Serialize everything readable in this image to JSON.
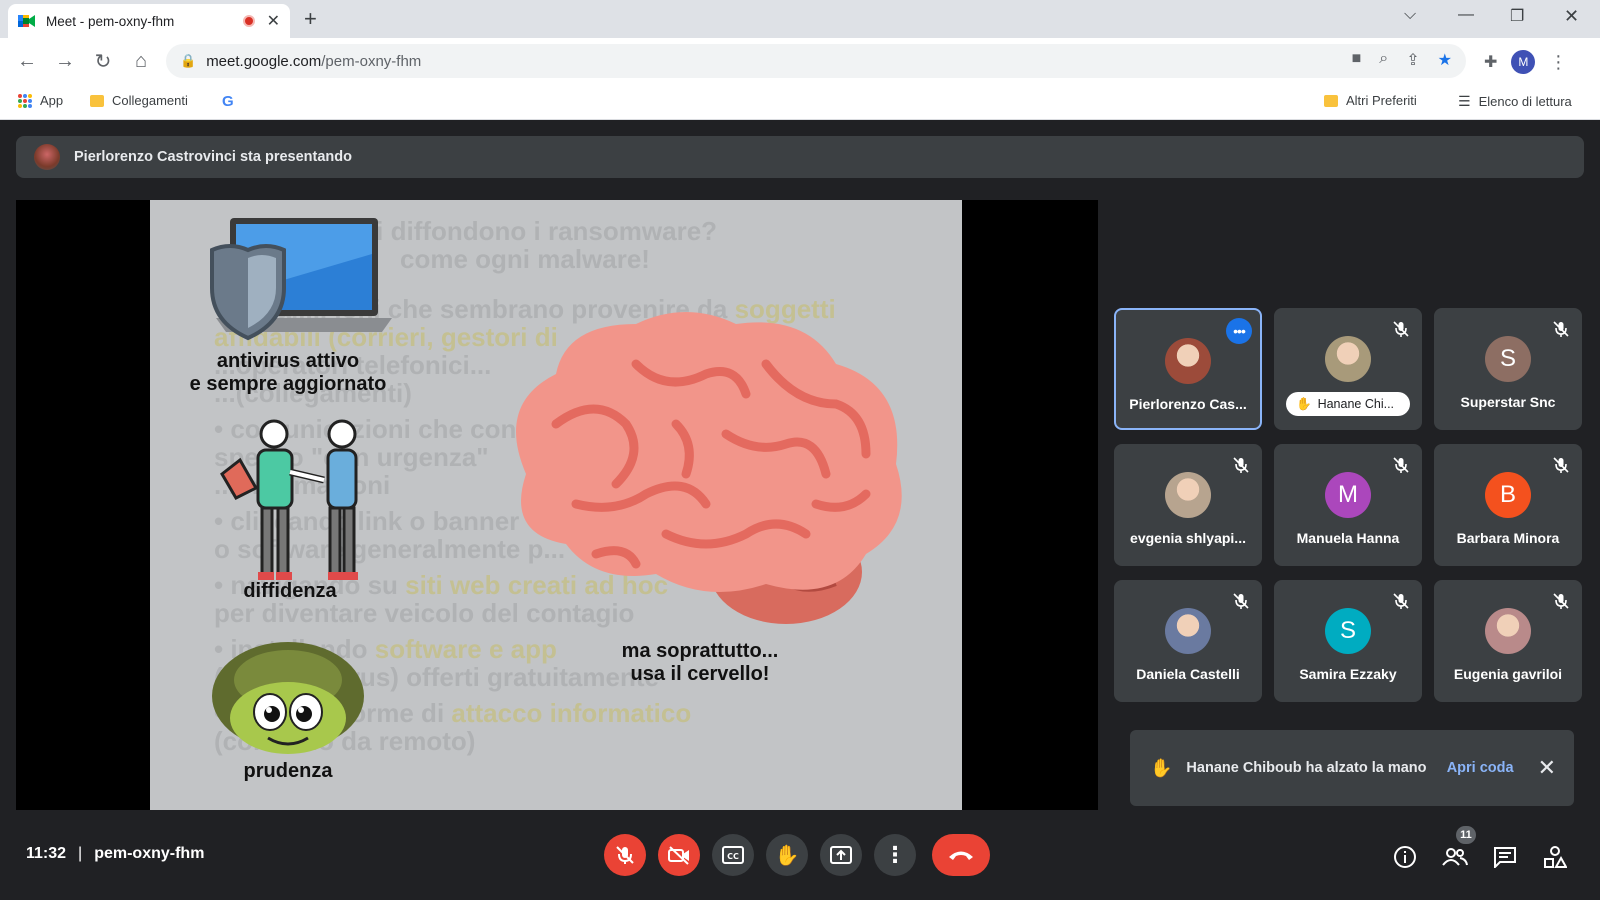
{
  "browser": {
    "tab_title": "Meet - pem-oxny-fhm",
    "tab_close": "✕",
    "new_tab": "+",
    "url_host": "meet.google.com",
    "url_path": "/pem-oxny-fhm",
    "bookmarks": {
      "apps": "App",
      "links": "Collegamenti",
      "google": "G",
      "other": "Altri Preferiti",
      "reading_list": "Elenco di lettura"
    },
    "profile_initial": "M"
  },
  "meet": {
    "presenter_banner": "Pierlorenzo Castrovinci sta presentando",
    "slide": {
      "ghost_lines": [
        {
          "t": "e si diffondono i ransomware?",
          "y": ""
        },
        {
          "t": "come ogni malware!",
          "y": ""
        },
        {
          "t": "• e-mail... ioni che sembrano provenire da ",
          "y": "soggetti"
        },
        {
          "t": "   ",
          "y": "affidabili (corrieri, gestori di"
        },
        {
          "t": "   ...operatori telefonici...",
          "y": ""
        },
        {
          "t": "   ...(collegamenti)",
          "y": ""
        },
        {
          "t": "• comunicazioni che con...",
          "y": ""
        },
        {
          "t": "   spesso \"con urgenza\"",
          "y": ""
        },
        {
          "t": "   ...informazioni",
          "y": ""
        },
        {
          "t": "• cliccando link o banner",
          "y": ""
        },
        {
          "t": "   o software generalmente p...",
          "y": ""
        },
        {
          "t": "• navigando su ",
          "y": "siti web creati ad hoc"
        },
        {
          "t": "   per diventare veicolo del contagio",
          "y": ""
        },
        {
          "t": "• installando ",
          "y": "software e app"
        },
        {
          "t": "   (falsi antivirus) offerti gratuitamente",
          "y": ""
        },
        {
          "t": "• ...sticate forme di ",
          "y": "attacco informatico"
        },
        {
          "t": "   (controllo da remoto)",
          "y": ""
        }
      ],
      "label_antivirus_1": "antivirus attivo",
      "label_antivirus_2": "e sempre aggiornato",
      "label_diffidenza": "diffidenza",
      "label_prudenza": "prudenza",
      "label_brain_1": "ma soprattutto...",
      "label_brain_2": "usa il cervello!"
    },
    "participants": [
      {
        "name": "Pierlorenzo Cas...",
        "kind": "photo",
        "color": "#9c4b3a",
        "active": true,
        "muted": false
      },
      {
        "name": "Hanane Chi...",
        "kind": "photo-chip",
        "color": "#a89a7a",
        "active": false,
        "muted": true
      },
      {
        "name": "Superstar Snc",
        "kind": "initial",
        "initial": "S",
        "color": "#8d6e63",
        "active": false,
        "muted": true
      },
      {
        "name": "evgenia shlyapi...",
        "kind": "photo",
        "color": "#b7a48f",
        "active": false,
        "muted": true
      },
      {
        "name": "Manuela Hanna",
        "kind": "initial",
        "initial": "M",
        "color": "#ab47bc",
        "active": false,
        "muted": true
      },
      {
        "name": "Barbara Minora",
        "kind": "initial",
        "initial": "B",
        "color": "#f4511e",
        "active": false,
        "muted": true
      },
      {
        "name": "Daniela Castelli",
        "kind": "photo",
        "color": "#6a7aa0",
        "active": false,
        "muted": true
      },
      {
        "name": "Samira Ezzaky",
        "kind": "initial",
        "initial": "S",
        "color": "#00acc1",
        "active": false,
        "muted": true
      },
      {
        "name": "Eugenia gavriloi",
        "kind": "photo",
        "color": "#b98a8a",
        "active": false,
        "muted": true
      }
    ],
    "toast": {
      "message": "Hanane Chiboub ha alzato la mano",
      "action": "Apri coda",
      "close": "✕"
    },
    "time": "11:32",
    "separator": "|",
    "meeting_code": "pem-oxny-fhm",
    "participant_count": "11"
  }
}
